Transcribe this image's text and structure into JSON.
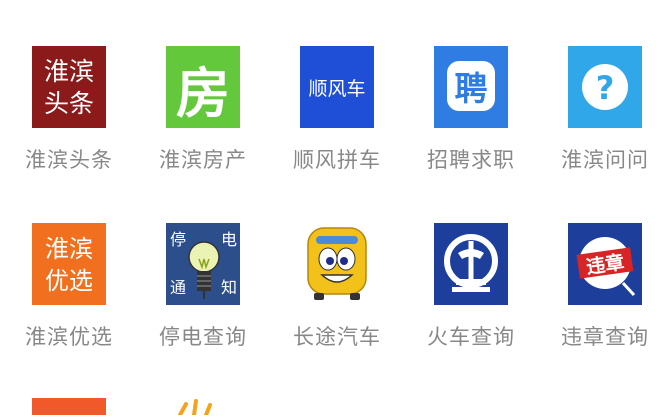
{
  "grid": {
    "items": [
      {
        "key": "huaibin-toutiao",
        "label": "淮滨头条",
        "icon": "huaibin-toutiao-icon",
        "icon_text": [
          "淮滨",
          "头条"
        ],
        "bg": "#8b1a1a"
      },
      {
        "key": "huaibin-fangchan",
        "label": "淮滨房产",
        "icon": "house-icon",
        "icon_text": [
          "房"
        ],
        "bg": "#64c83c"
      },
      {
        "key": "shunfeng-pinche",
        "label": "顺风拼车",
        "icon": "carpool-icon",
        "icon_text": [
          "顺风车"
        ],
        "bg": "#1f4fd6"
      },
      {
        "key": "zhaopin-qiuzhi",
        "label": "招聘求职",
        "icon": "recruit-icon",
        "icon_text": [
          "聘"
        ],
        "bg": "#2f7de3"
      },
      {
        "key": "huaibin-wenwen",
        "label": "淮滨问问",
        "icon": "question-icon",
        "icon_text": [
          "?"
        ],
        "bg": "#2fa7e8"
      },
      {
        "key": "huaibin-youxuan",
        "label": "淮滨优选",
        "icon": "youxuan-icon",
        "icon_text": [
          "淮滨",
          "优选"
        ],
        "bg": "#f1701f"
      },
      {
        "key": "tingdian-chaxun",
        "label": "停电查询",
        "icon": "lightbulb-icon",
        "icon_text": [
          "停",
          "电",
          "通",
          "知"
        ],
        "bg": "#2c4f8c"
      },
      {
        "key": "changtu-qiche",
        "label": "长途汽车",
        "icon": "bus-icon",
        "icon_text": [],
        "bg": "#ffffff"
      },
      {
        "key": "huoche-chaxun",
        "label": "火车查询",
        "icon": "railway-icon",
        "icon_text": [],
        "bg": "#1d3f9b"
      },
      {
        "key": "weizhang-chaxun",
        "label": "违章查询",
        "icon": "traffic-violation-icon",
        "icon_text": [
          "违章"
        ],
        "bg": "#1d3f9b"
      }
    ]
  }
}
